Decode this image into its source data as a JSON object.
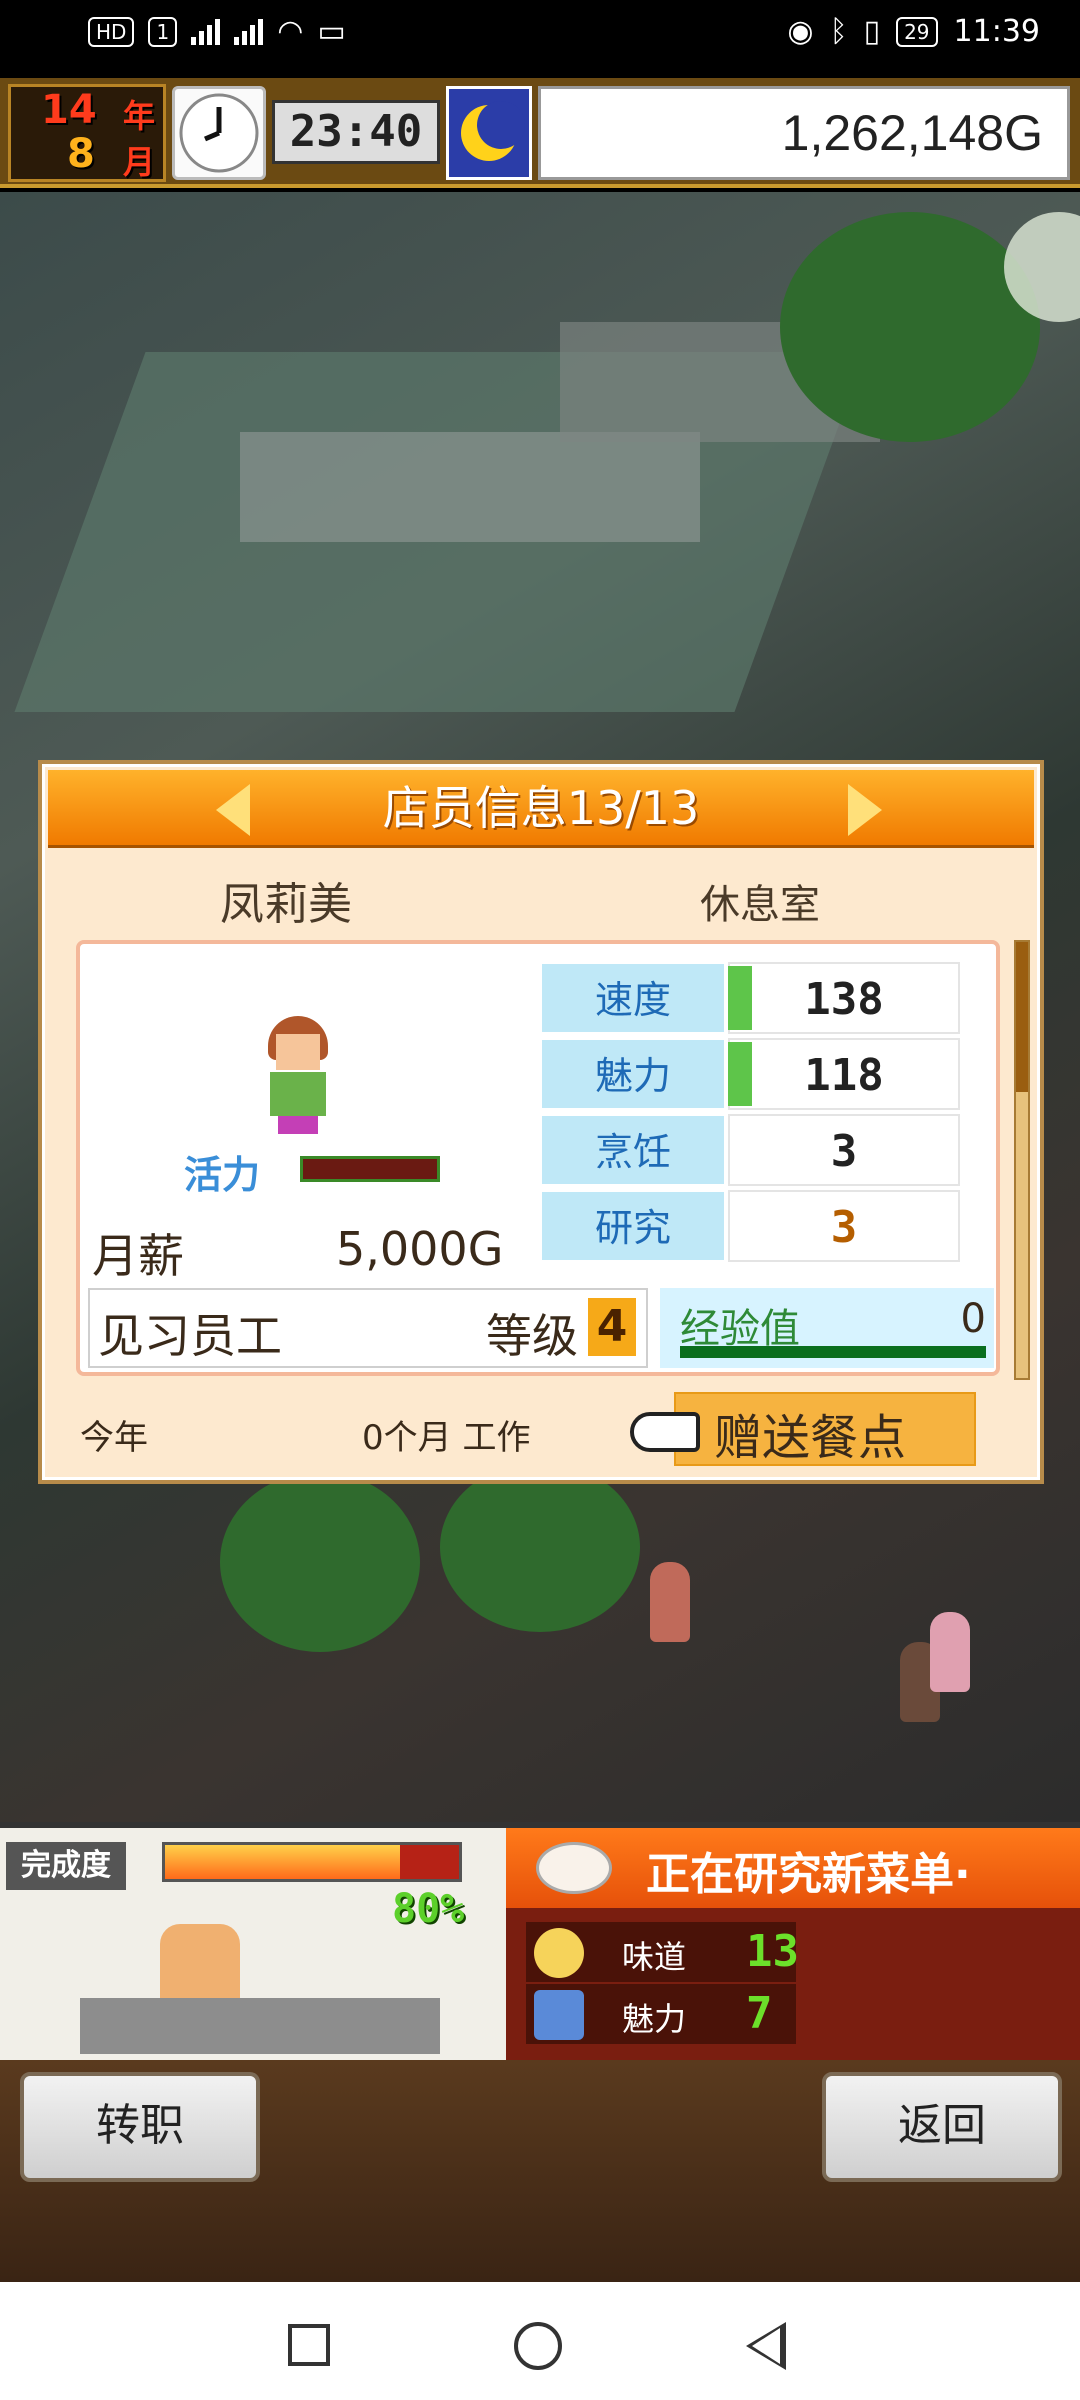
{
  "status_bar": {
    "left": [
      "HD",
      "1",
      "4G",
      "4G"
    ],
    "battery": "29",
    "time": "11:39"
  },
  "hud": {
    "year_num": "14",
    "year_unit": "年",
    "month_num": "8",
    "month_unit": "月",
    "time": "23:40",
    "money": "1,262,148G"
  },
  "dialog": {
    "title": "店员信息13/13",
    "staff_name": "凤莉美",
    "location": "休息室",
    "vitality_label": "活力",
    "salary_label": "月薪",
    "salary_value": "5,000G",
    "rank_title": "见习员工",
    "level_label": "等级",
    "level_value": "4",
    "exp_label": "经验值",
    "exp_value": "0",
    "stats": [
      {
        "label": "速度",
        "value": "138"
      },
      {
        "label": "魅力",
        "value": "118"
      },
      {
        "label": "烹饪",
        "value": "3"
      },
      {
        "label": "研究",
        "value": "3"
      }
    ],
    "year_label": "今年",
    "work_label": "0个月 工作",
    "gift_button": "赠送餐点"
  },
  "bottom": {
    "complete_label": "完成度",
    "complete_percent": "80%",
    "complete_fraction": 0.8,
    "research_title": "正在研究新菜单·",
    "research_rows": [
      {
        "label": "味道",
        "value": "13"
      },
      {
        "label": "魅力",
        "value": "7"
      }
    ]
  },
  "buttons": {
    "transfer": "转职",
    "back": "返回"
  }
}
